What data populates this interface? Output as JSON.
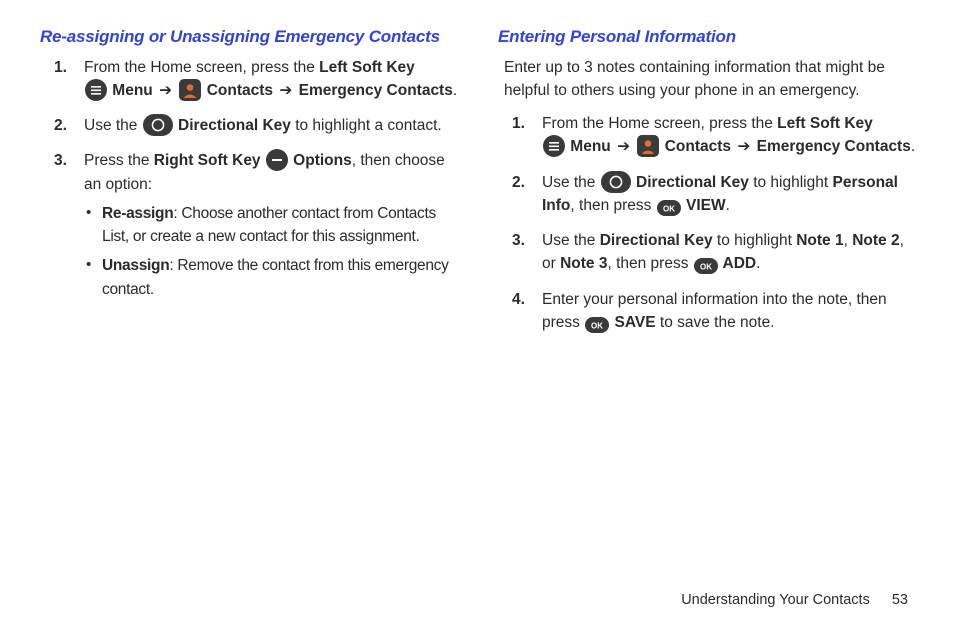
{
  "left": {
    "heading": "Re-assigning or Unassigning Emergency Contacts",
    "steps": {
      "s1": {
        "num": "1.",
        "a": "From the Home screen, press the ",
        "b": "Left Soft Key",
        "menu": " Menu ",
        "arrow": "➔",
        "contacts": " Contacts ",
        "ec": " Emergency Contacts",
        "dot": "."
      },
      "s2": {
        "num": "2.",
        "a": "Use the ",
        "dk": " Directional Key",
        "b": " to highlight a contact."
      },
      "s3": {
        "num": "3.",
        "a": "Press the ",
        "rsk": "Right Soft Key",
        "opts": " Options",
        "b": ", then choose an option:",
        "bul1a": "Re-assign",
        "bul1b": ": Choose another contact from Contacts List, or create a new contact for this assignment.",
        "bul2a": "Unassign",
        "bul2b": ": Remove the contact from this emergency contact."
      }
    }
  },
  "right": {
    "heading": "Entering Personal Information",
    "intro": "Enter up to 3 notes containing information that might be helpful to others using your phone in an emergency.",
    "steps": {
      "s1": {
        "num": "1.",
        "a": "From the Home screen, press the ",
        "b": "Left Soft Key",
        "menu": " Menu ",
        "arrow": "➔",
        "contacts": " Contacts ",
        "ec": " Emergency Contacts",
        "dot": "."
      },
      "s2": {
        "num": "2.",
        "a": "Use the ",
        "dk": " Directional Key",
        "b": " to highlight ",
        "pi": "Personal Info",
        "c": ", then press ",
        "view": " VIEW",
        "dot": "."
      },
      "s3": {
        "num": "3.",
        "a": "Use the ",
        "dk": "Directional Key",
        "b": " to highlight ",
        "n1": "Note 1",
        "comma": ", ",
        "n2": "Note 2",
        "or": ", or ",
        "n3": "Note 3",
        "c": ", then press ",
        "add": " ADD",
        "dot": "."
      },
      "s4": {
        "num": "4.",
        "a": "Enter your personal information into the note, then press ",
        "save": " SAVE",
        "b": " to save the note."
      }
    }
  },
  "footer": {
    "section": "Understanding Your Contacts",
    "page": "53"
  }
}
